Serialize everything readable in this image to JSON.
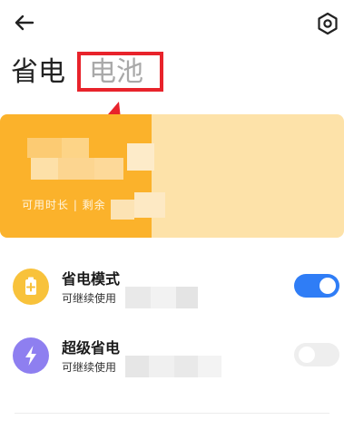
{
  "tabs": {
    "power_saving": "省电",
    "battery": "电池"
  },
  "battery_card": {
    "usage_label": "可用时长 | 剩余",
    "charge_fraction": 0.44,
    "fill_color": "#fbb22b",
    "track_color": "#fde2a9"
  },
  "settings": [
    {
      "title": "省电模式",
      "subtitle": "可继续使用",
      "enabled": true,
      "icon": "battery-plus-icon",
      "icon_color": "#f8c23b"
    },
    {
      "title": "超级省电",
      "subtitle": "可继续使用",
      "enabled": false,
      "icon": "lightning-icon",
      "icon_color": "#8e7ff0"
    }
  ],
  "colors": {
    "annotation_red": "#e8232b",
    "toggle_on": "#2f7df6",
    "toggle_off": "#eeeeee"
  }
}
